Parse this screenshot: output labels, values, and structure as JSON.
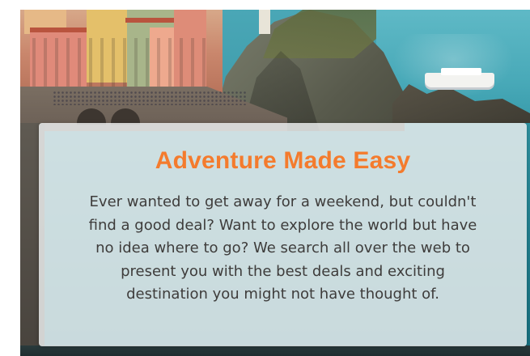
{
  "hero": {
    "image_icon": "photo-coastal-village",
    "colors": {
      "sea": "#2f93a2",
      "cliff": "#6a6d5d"
    }
  },
  "card": {
    "title": "Adventure Made Easy",
    "body_lines": [
      "Ever wanted to get away for a weekend, but couldn't",
      "find a good deal? Want to explore the world but have",
      "no idea where to go? We search all over the web to",
      "present you with the best deals and exciting",
      "destination you might not have thought of."
    ],
    "colors": {
      "title": "#f47b2d",
      "body": "#3e3c3b",
      "background": "#eceeee"
    }
  }
}
